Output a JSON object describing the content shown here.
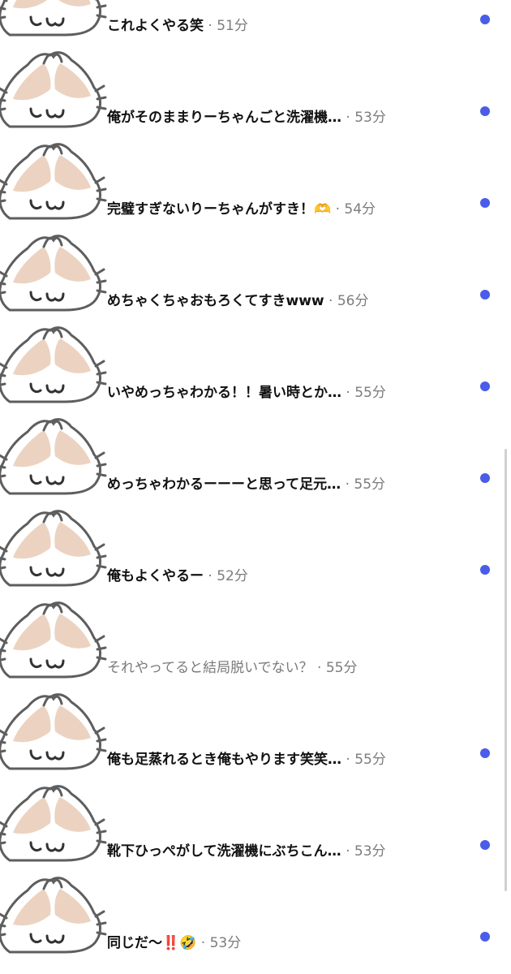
{
  "colors": {
    "unread_dot": "#4a5ce8",
    "message_unread": "#111111",
    "message_read": "#7a7a7a",
    "meta": "#7c7c7c"
  },
  "avatar_icon": "cat-face-avatar-icon",
  "separator": "·",
  "threads": [
    {
      "message": "これよくやる笑",
      "time": "51分",
      "unread": true
    },
    {
      "message": "俺がそのままりーちゃんごと洗濯機…",
      "time": "53分",
      "unread": true
    },
    {
      "message": "完璧すぎないりーちゃんがすき！🫶",
      "time": "54分",
      "unread": true
    },
    {
      "message": "めちゃくちゃおもろくてすきwww",
      "time": "56分",
      "unread": true
    },
    {
      "message": "いやめっちゃわかる！！暑い時とか…",
      "time": "55分",
      "unread": true
    },
    {
      "message": "めっちゃわかるーーーと思って足元…",
      "time": "55分",
      "unread": true
    },
    {
      "message": "俺もよくやるー",
      "time": "52分",
      "unread": true
    },
    {
      "message": "それやってると結局脱いでない？",
      "time": "55分",
      "unread": false
    },
    {
      "message": "俺も足蒸れるとき俺もやります笑笑…",
      "time": "55分",
      "unread": true
    },
    {
      "message": "靴下ひっぺがして洗濯機にぶちこん…",
      "time": "53分",
      "unread": true
    },
    {
      "message": "同じだ〜‼️🤣",
      "time": "53分",
      "unread": true
    }
  ]
}
